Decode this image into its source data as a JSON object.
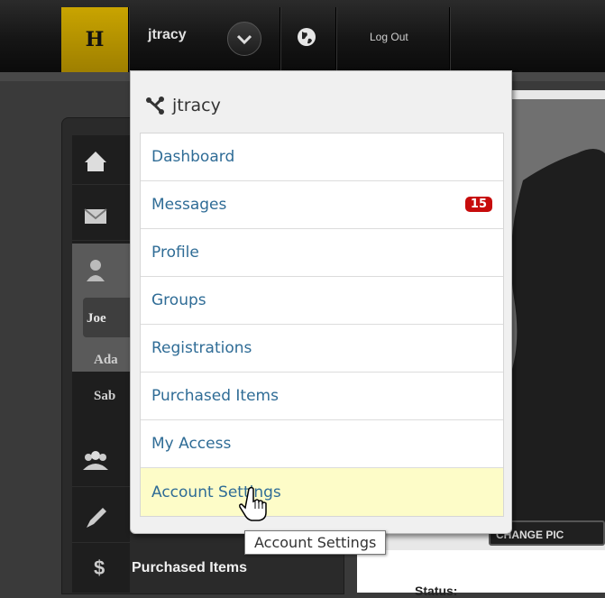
{
  "topbar": {
    "logo": "H",
    "username": "jtracy",
    "logout_label": "Log Out",
    "icons": [
      "chevron-down-icon",
      "globe-icon"
    ]
  },
  "dropdown": {
    "title": "jtracy",
    "title_icon": "network-icon",
    "items": [
      {
        "label": "Dashboard"
      },
      {
        "label": "Messages",
        "badge": "15"
      },
      {
        "label": "Profile"
      },
      {
        "label": "Groups"
      },
      {
        "label": "Registrations"
      },
      {
        "label": "Purchased Items"
      },
      {
        "label": "My Access"
      },
      {
        "label": "Account Settings",
        "hovered": true
      }
    ]
  },
  "tooltip": "Account Settings",
  "sidebar": {
    "sub_items": [
      "Joe",
      "Ada",
      "Sab"
    ],
    "purchased_label": "Purchased Items",
    "purchased_icon": "$"
  },
  "main": {
    "change_pic_label": "CHANGE PIC",
    "status_label": "Status:"
  },
  "colors": {
    "accent_gold": "#b89500",
    "link": "#2f6c96",
    "badge": "#c70c0c",
    "hover": "#fdfcc8"
  }
}
